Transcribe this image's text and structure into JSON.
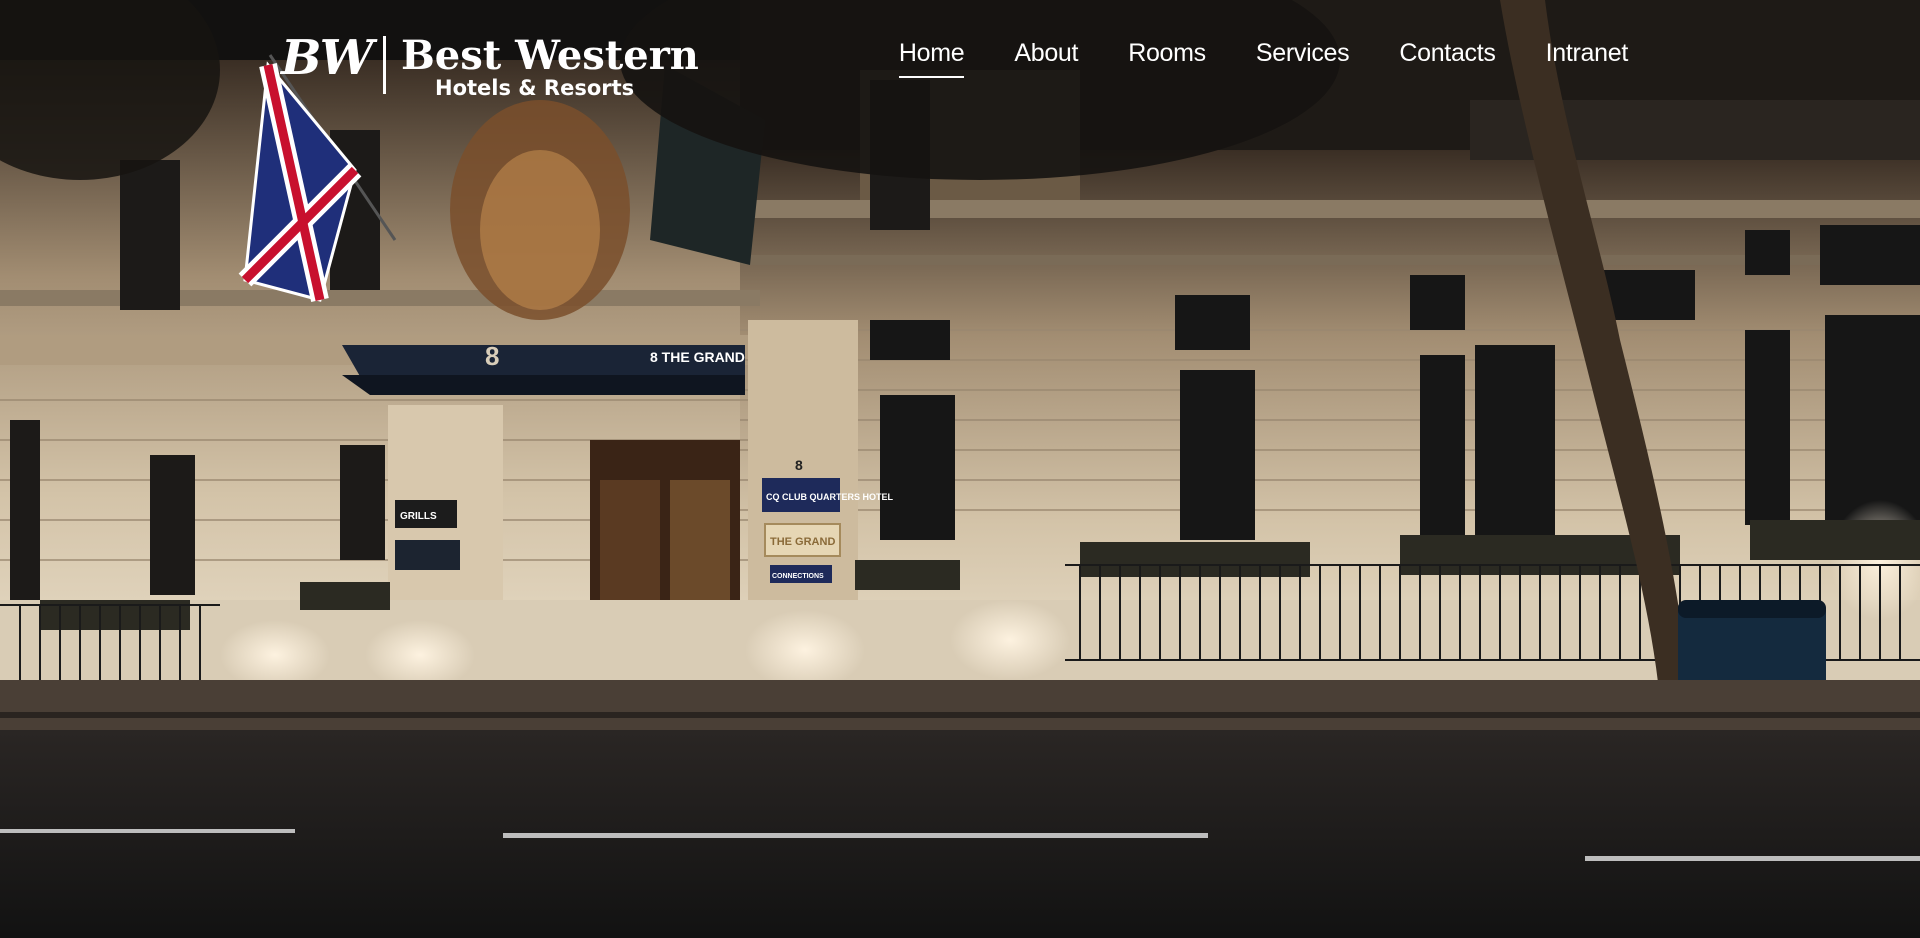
{
  "brand": {
    "logo_mark": "BW",
    "name": "Best Western",
    "tagline": "Hotels & Resorts"
  },
  "nav": {
    "items": [
      {
        "label": "Home",
        "active": true
      },
      {
        "label": "About",
        "active": false
      },
      {
        "label": "Rooms",
        "active": false
      },
      {
        "label": "Services",
        "active": false
      },
      {
        "label": "Contacts",
        "active": false
      },
      {
        "label": "Intranet",
        "active": false
      }
    ]
  },
  "hero": {
    "address_number": "8",
    "canopy_sign": "8 THE GRAND",
    "cq_sign": "CQ CLUB QUARTERS HOTEL",
    "grand_plaque": "THE GRAND",
    "grills_sign": "GRILLS",
    "connections_sign": "CONNECTIONS"
  },
  "colors": {
    "text": "#ffffff",
    "night_sky": "#141414",
    "facade": "#c9b9a1",
    "road": "#1e1e1e",
    "canopy": "#1a2436"
  }
}
